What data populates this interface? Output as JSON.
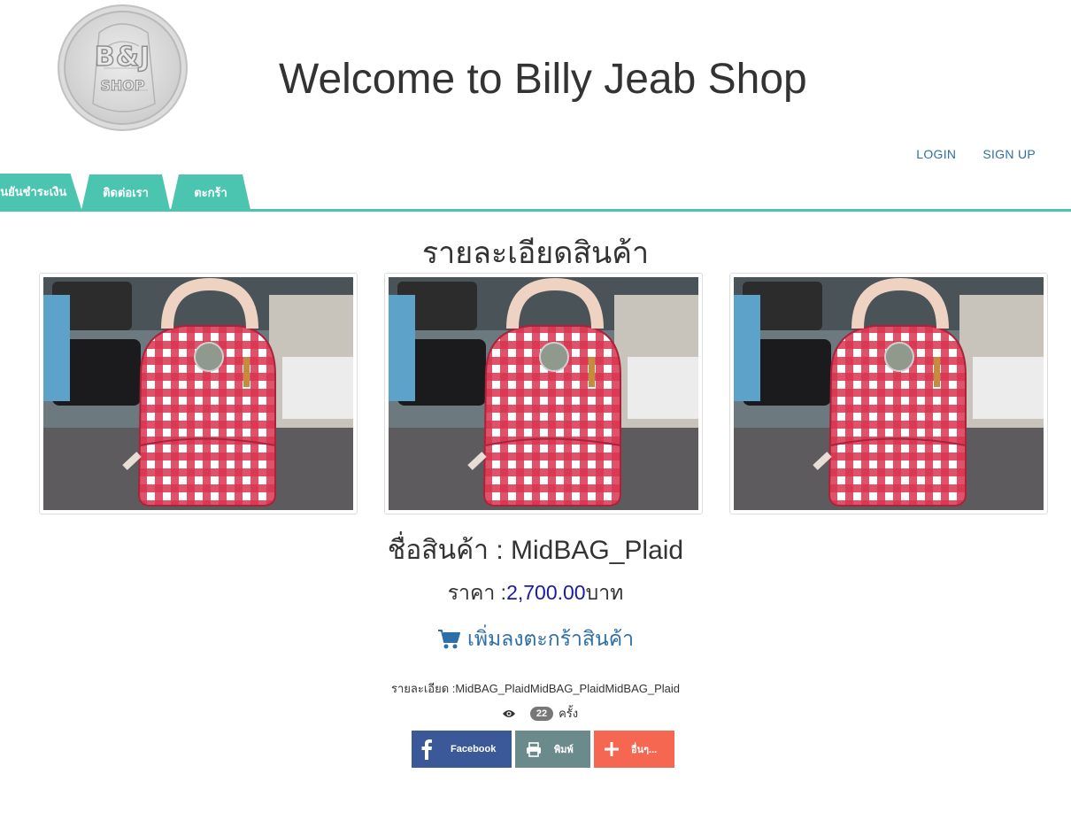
{
  "logo": {
    "main": "B&J",
    "sub": "SHOP"
  },
  "header": {
    "title": "Welcome to Billy Jeab Shop"
  },
  "auth": {
    "login": "LOGIN",
    "signup": "SIGN UP"
  },
  "tabs": [
    {
      "label": "ยืนยันชำระเงิน"
    },
    {
      "label": "ติดต่อเรา"
    },
    {
      "label": "ตะกร้า"
    }
  ],
  "product": {
    "section_title": "รายละเอียดสินค้า",
    "name_label": "ชื่อสินค้า : ",
    "name": "MidBAG_Plaid",
    "price_label": "ราคา :",
    "price": "2,700.00",
    "currency": "บาท",
    "add_to_cart": "เพิ่มลงตะกร้าสินค้า",
    "description": "รายละเอียด :MidBAG_PlaidMidBAG_PlaidMidBAG_Plaid",
    "views_count": "22",
    "views_unit": "ครั้ง"
  },
  "share": {
    "facebook": "Facebook",
    "print": "พิมพ์",
    "more": "อื่นๆ..."
  },
  "colors": {
    "accent": "#4bc4b0",
    "link": "#2d6fa8",
    "price": "#1a1aa6",
    "facebook": "#3b5998",
    "print": "#6b8a8c",
    "more": "#f56750"
  }
}
